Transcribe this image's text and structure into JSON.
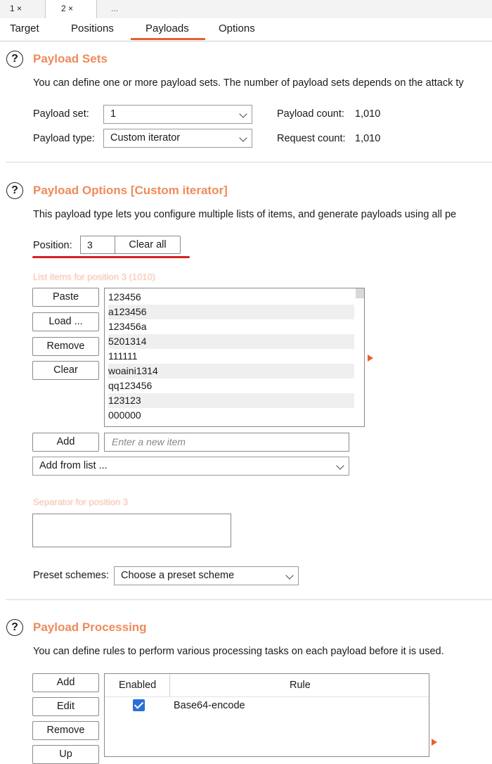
{
  "top_tabs": [
    {
      "label": "1 ×"
    },
    {
      "label": "2 ×"
    },
    {
      "label": "..."
    }
  ],
  "sub_tabs": [
    {
      "label": "Target"
    },
    {
      "label": "Positions"
    },
    {
      "label": "Payloads"
    },
    {
      "label": "Options"
    }
  ],
  "active_sub_tab": "Payloads",
  "payload_sets": {
    "title": "Payload Sets",
    "description": "You can define one or more payload sets. The number of payload sets depends on the attack ty",
    "set_label": "Payload set:",
    "set_value": "1",
    "type_label": "Payload type:",
    "type_value": "Custom iterator",
    "payload_count_label": "Payload count:",
    "payload_count": "1,010",
    "request_count_label": "Request count:",
    "request_count": "1,010"
  },
  "payload_options": {
    "title": "Payload Options [Custom iterator]",
    "description": "This payload type lets you configure multiple lists of items, and generate payloads using all pe",
    "position_label": "Position:",
    "position_value": "3",
    "clear_all": "Clear all",
    "list_caption": "List items for position 3 (1010)",
    "buttons": [
      "Paste",
      "Load ...",
      "Remove",
      "Clear"
    ],
    "items": [
      "123456",
      "a123456",
      "123456a",
      "5201314",
      "111111",
      "woaini1314",
      "qq123456",
      "123123",
      "000000"
    ],
    "add_button": "Add",
    "add_placeholder": "Enter a new item",
    "add_from_list": "Add from list ...",
    "separator_caption": "Separator for position 3",
    "preset_label": "Preset schemes:",
    "preset_value": "Choose a preset scheme"
  },
  "payload_processing": {
    "title": "Payload Processing",
    "description": "You can define rules to perform various processing tasks on each payload before it is used.",
    "buttons": [
      "Add",
      "Edit",
      "Remove",
      "Up"
    ],
    "columns": [
      "Enabled",
      "Rule"
    ],
    "rows": [
      {
        "enabled": true,
        "rule": "Base64-encode"
      }
    ]
  },
  "colors": {
    "accent": "#e8602c",
    "section_title": "#f08a5a",
    "highlight_underline": "#d42222",
    "checkbox": "#2a6fd6"
  },
  "icons": [
    "help-icon",
    "chevron-down-icon",
    "expand-arrow-icon",
    "checkbox-checked-icon"
  ]
}
